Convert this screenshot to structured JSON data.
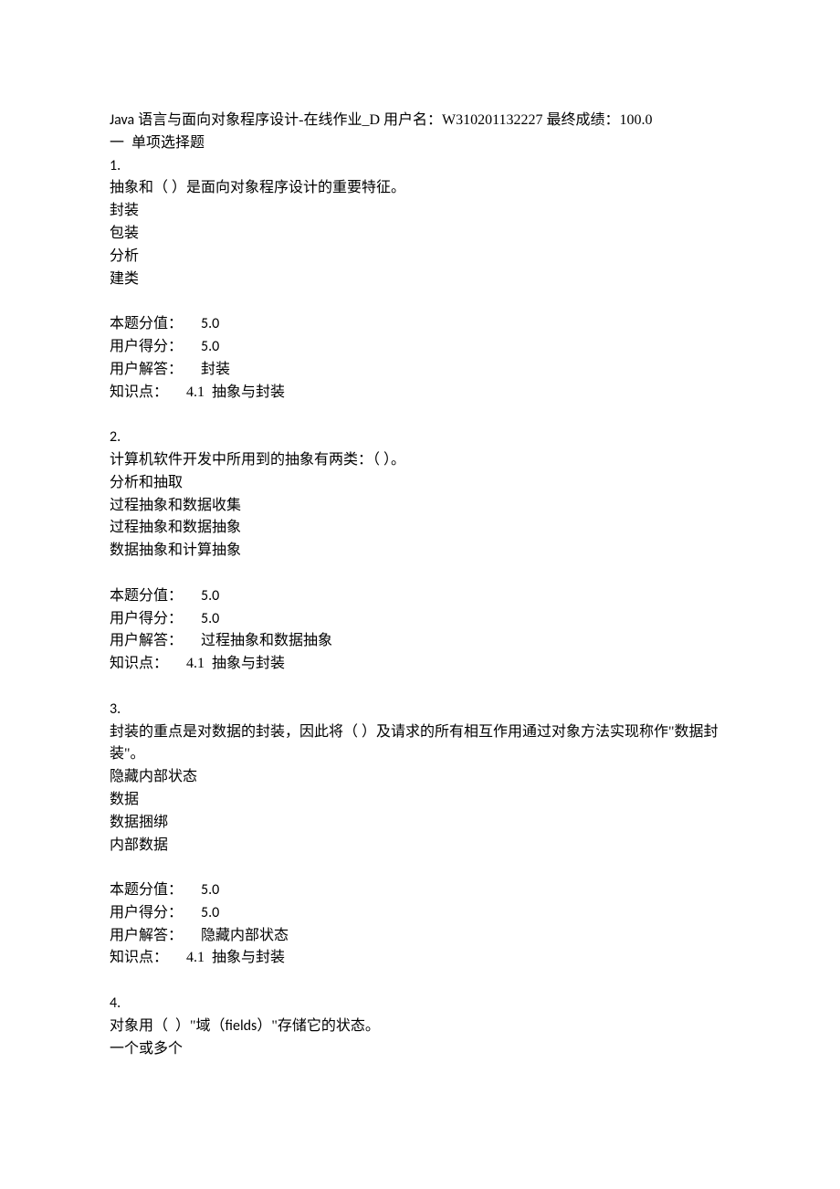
{
  "header": {
    "course": "Java",
    "title_rest": " 语言与面向对象程序设计-在线作业_D 用户名：W310201132227 最终成绩：100.0"
  },
  "section": {
    "label": "一  单项选择题"
  },
  "questions": [
    {
      "number": "1.",
      "stem": "抽象和（ ）是面向对象程序设计的重要特征。",
      "options": [
        "封装",
        "包装",
        "分析",
        "建类"
      ],
      "score_value": "5.0",
      "user_score": "5.0",
      "user_answer": "封装",
      "knowledge_point": "4.1  抽象与封装"
    },
    {
      "number": "2.",
      "stem": "计算机软件开发中所用到的抽象有两类：（ ）。",
      "options": [
        "分析和抽取",
        "过程抽象和数据收集",
        "过程抽象和数据抽象",
        "数据抽象和计算抽象"
      ],
      "score_value": "5.0",
      "user_score": "5.0",
      "user_answer": "过程抽象和数据抽象",
      "knowledge_point": "4.1  抽象与封装"
    },
    {
      "number": "3.",
      "stem": "封装的重点是对数据的封装，因此将（ ）及请求的所有相互作用通过对象方法实现称作\"数据封装\"。",
      "options": [
        "隐藏内部状态",
        "数据",
        "数据捆绑",
        "内部数据"
      ],
      "score_value": "5.0",
      "user_score": "5.0",
      "user_answer": "隐藏内部状态",
      "knowledge_point": "4.1  抽象与封装"
    },
    {
      "number": "4.",
      "stem_pre": "对象用（  ）\"域（",
      "stem_mid": "fields",
      "stem_post": "）\"存储它的状态。",
      "options": [
        "一个或多个"
      ],
      "score_value": "",
      "user_score": "",
      "user_answer": "",
      "knowledge_point": ""
    }
  ],
  "labels": {
    "score_value": "本题分值：",
    "user_score": "用户得分：",
    "user_answer": "用户解答：",
    "knowledge_point": "知识点："
  }
}
